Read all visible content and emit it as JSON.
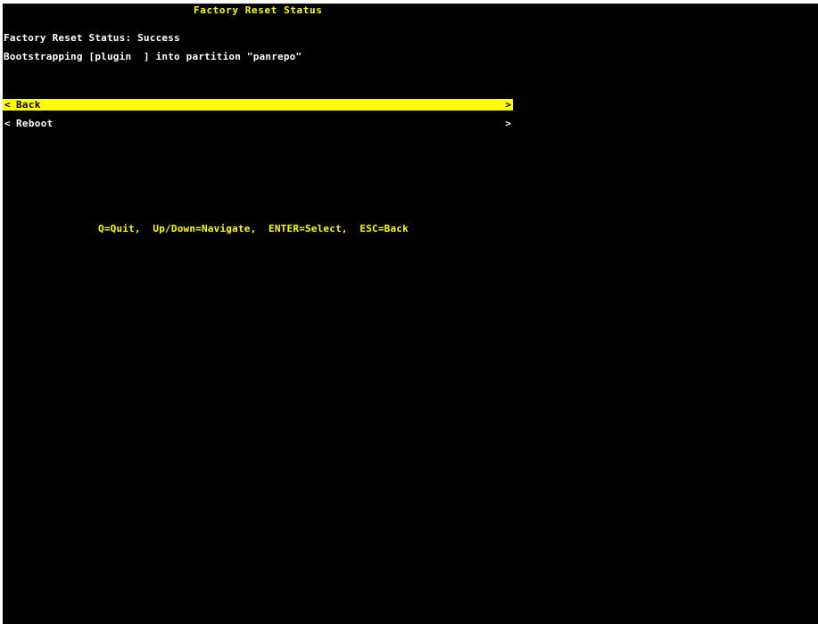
{
  "screen": {
    "title": "Factory Reset Status",
    "status_line": "Factory Reset Status: Success",
    "bootstrap_line": "Bootstrapping [plugin  ] into partition \"panrepo\""
  },
  "menu": {
    "items": [
      {
        "label": "Back",
        "left_marker": "<",
        "right_marker": ">",
        "selected": true
      },
      {
        "label": "Reboot",
        "left_marker": "<",
        "right_marker": ">",
        "selected": false
      }
    ]
  },
  "footer": {
    "hint": "Q=Quit,  Up/Down=Navigate,  ENTER=Select,  ESC=Back"
  },
  "colors": {
    "background": "#000000",
    "highlight": "#ffff00",
    "text": "#ffffff"
  }
}
